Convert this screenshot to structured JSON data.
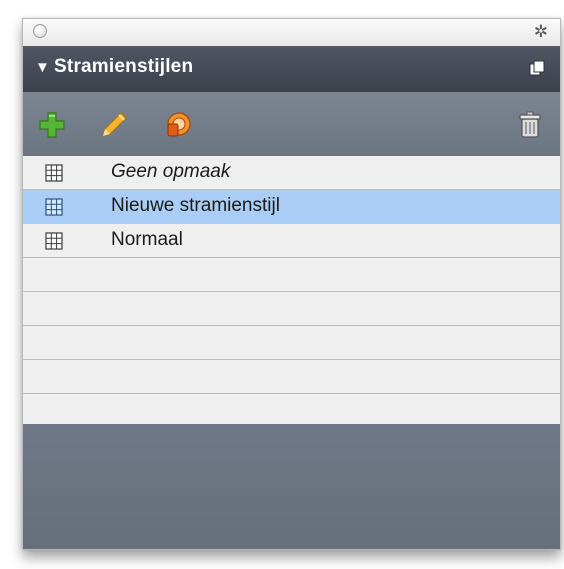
{
  "panel": {
    "title": "Stramienstijlen",
    "disclosure": "▼",
    "title_icons": {
      "close": "close-circle-icon",
      "options": "gear-icon",
      "panel_menu": "panel-menu-icon"
    }
  },
  "toolbar": {
    "buttons": [
      {
        "name": "new-style-button",
        "icon": "plus-icon",
        "color": "#4fae2f"
      },
      {
        "name": "edit-style-button",
        "icon": "pencil-icon",
        "color": "#f5a623"
      },
      {
        "name": "duplicate-style-button",
        "icon": "duplicate-icon",
        "color": "#e8751a"
      },
      {
        "name": "delete-style-button",
        "icon": "trash-icon",
        "color": "#d8d8d8"
      }
    ]
  },
  "styles": [
    {
      "label": "Geen opmaak",
      "italic": true,
      "selected": false
    },
    {
      "label": "Nieuwe stramienstijl",
      "italic": false,
      "selected": true
    },
    {
      "label": "Normaal",
      "italic": false,
      "selected": false
    }
  ],
  "colors": {
    "header": "#454b55",
    "toolbar": "#747d8a",
    "selection": "#a9cdf6"
  }
}
